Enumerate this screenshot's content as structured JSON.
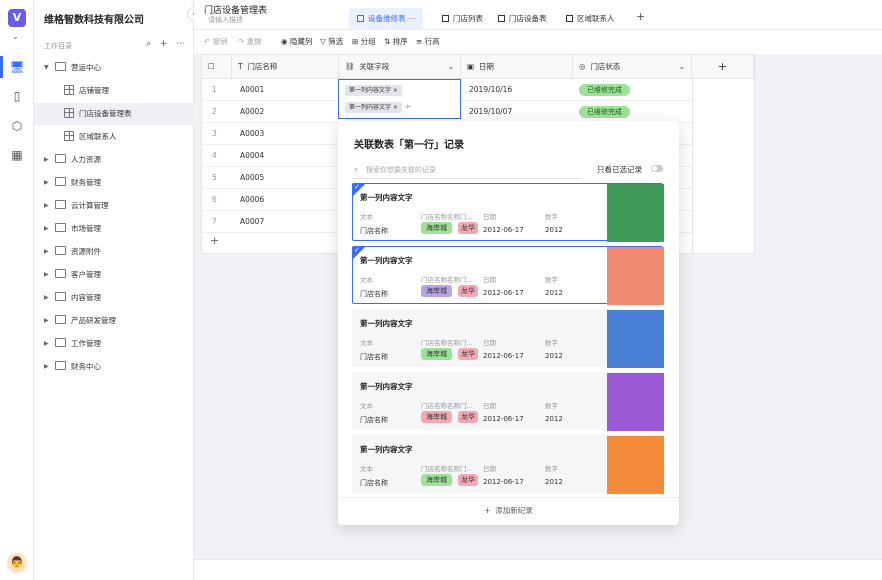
{
  "org_name": "维格智数科技有限公司",
  "workspace_label": "工作目录",
  "workspace_tools": "⌕ + ⋯",
  "tree": [
    {
      "label": "营运中心",
      "level": 0,
      "expanded": true
    },
    {
      "label": "店铺管理",
      "level": 1,
      "type": "table"
    },
    {
      "label": "门店设备管理表",
      "level": 1,
      "type": "table",
      "selected": true
    },
    {
      "label": "区域联系人",
      "level": 1,
      "type": "table"
    },
    {
      "label": "人力资源",
      "level": 0
    },
    {
      "label": "财务管理",
      "level": 0
    },
    {
      "label": "云计算管理",
      "level": 0
    },
    {
      "label": "市场管理",
      "level": 0
    },
    {
      "label": "资源附件",
      "level": 0
    },
    {
      "label": "客户管理",
      "level": 0
    },
    {
      "label": "内容管理",
      "level": 0
    },
    {
      "label": "产品研发管理",
      "level": 0
    },
    {
      "label": "工作管理",
      "level": 0
    },
    {
      "label": "财务中心",
      "level": 0
    }
  ],
  "sheet_title": "门店设备管理表",
  "sheet_desc": "请输入描述",
  "tabs": [
    {
      "label": "设备维修表",
      "active": true,
      "more": "⋯"
    },
    {
      "label": "门店列表"
    },
    {
      "label": "门店设备表"
    },
    {
      "label": "区域联系人"
    }
  ],
  "toolbar": {
    "undo": "撤销",
    "redo": "重做",
    "hide": "隐藏列",
    "filter": "筛选",
    "group": "分组",
    "sort": "排序",
    "row_height": "行高"
  },
  "columns": [
    "门店名称",
    "关联字段",
    "日期",
    "门店状态"
  ],
  "rows": [
    {
      "idx": "1",
      "name": "A0001",
      "date": "2019/10/16",
      "status": "已维修完成"
    },
    {
      "idx": "2",
      "name": "A0002",
      "date": "2019/10/07",
      "status": "已维修完成"
    },
    {
      "idx": "3",
      "name": "A0003"
    },
    {
      "idx": "4",
      "name": "A0004"
    },
    {
      "idx": "5",
      "name": "A0005"
    },
    {
      "idx": "6",
      "name": "A0006"
    },
    {
      "idx": "7",
      "name": "A0007"
    }
  ],
  "link_tags": [
    "第一列内容文字",
    "第一列内容文字"
  ],
  "popup": {
    "title": "关联数表「第一行」记录",
    "search_placeholder": "搜索你想要关联的记录",
    "only_selected": "只看已选记录",
    "add_new": "添加新纪录",
    "field_labels": [
      "文本",
      "门店名称名称门...",
      "日期",
      "数字"
    ],
    "cards": [
      {
        "title": "第一列内容文字",
        "checked": true,
        "val": "门店名称",
        "tag1": "海岸城",
        "tag1_color": "#9ee29a",
        "tag2": "龙华",
        "date": "2012-06-17",
        "num": "2012",
        "img_bg": "#3f9a5a"
      },
      {
        "title": "第一列内容文字",
        "checked": true,
        "val": "门店名称",
        "tag1": "海岸城",
        "tag1_color": "#b9a3f0",
        "tag2": "龙华",
        "date": "2012-06-17",
        "num": "2012",
        "img_bg": "#f08a72"
      },
      {
        "title": "第一列内容文字",
        "checked": false,
        "val": "门店名称",
        "tag1": "海岸城",
        "tag1_color": "#9ee29a",
        "tag2": "龙华",
        "date": "2012-06-17",
        "num": "2012",
        "img_bg": "#4a7fd6"
      },
      {
        "title": "第一列内容文字",
        "checked": false,
        "val": "门店名称",
        "tag1": "海岸城",
        "tag1_color": "#f4a8b3",
        "tag2": "龙华",
        "date": "2012-06-17",
        "num": "2012",
        "img_bg": "#9a5ad6"
      },
      {
        "title": "第一列内容文字",
        "checked": false,
        "val": "门店名称",
        "tag1": "海岸城",
        "tag1_color": "#9ee29a",
        "tag2": "龙华",
        "date": "2012-06-17",
        "num": "2012",
        "img_bg": "#f28a3a"
      }
    ]
  },
  "colors": {
    "accent": "#3b6cf6",
    "status_green": "#9ee29a",
    "tag2": "#f4a8b3"
  }
}
